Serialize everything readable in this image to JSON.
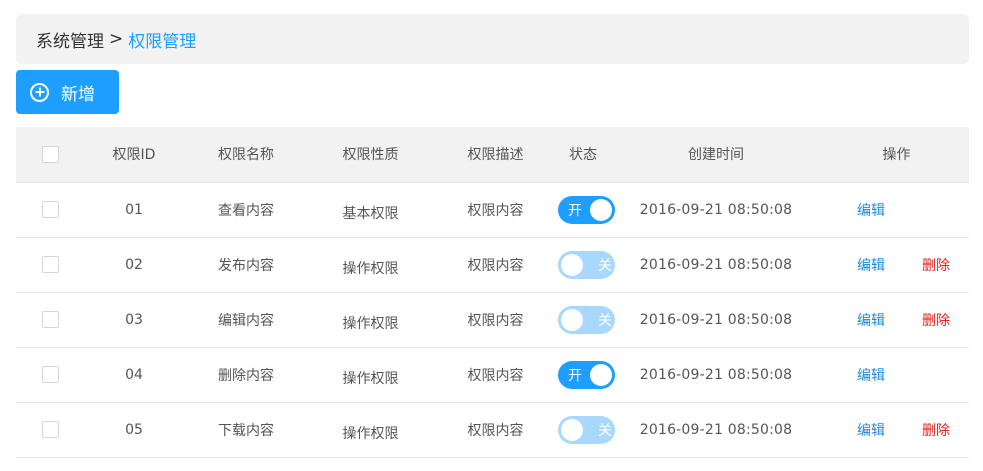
{
  "breadcrumb": {
    "root": "系统管理",
    "separator": ">",
    "current": "权限管理"
  },
  "toolbar": {
    "add_label": "新增",
    "add_icon": "plus-circle-icon"
  },
  "table": {
    "headers": {
      "id": "权限ID",
      "name": "权限名称",
      "nature": "权限性质",
      "desc": "权限描述",
      "status": "状态",
      "created": "创建时间",
      "ops": "操作"
    },
    "rows": [
      {
        "id": "01",
        "name": "查看内容",
        "nature": "基本权限",
        "desc": "权限内容",
        "status": "开",
        "created": "2016-09-21  08:50:08",
        "edit": "编辑",
        "delete": ""
      },
      {
        "id": "02",
        "name": "发布内容",
        "nature": "操作权限",
        "desc": "权限内容",
        "status": "关",
        "created": "2016-09-21  08:50:08",
        "edit": "编辑",
        "delete": "删除"
      },
      {
        "id": "03",
        "name": "编辑内容",
        "nature": "操作权限",
        "desc": "权限内容",
        "status": "关",
        "created": "2016-09-21  08:50:08",
        "edit": "编辑",
        "delete": "删除"
      },
      {
        "id": "04",
        "name": "删除内容",
        "nature": "操作权限",
        "desc": "权限内容",
        "status": "开",
        "created": "2016-09-21  08:50:08",
        "edit": "编辑",
        "delete": ""
      },
      {
        "id": "05",
        "name": "下载内容",
        "nature": "操作权限",
        "desc": "权限内容",
        "status": "关",
        "created": "2016-09-21  08:50:08",
        "edit": "编辑",
        "delete": "删除"
      }
    ]
  },
  "colors": {
    "accent": "#1e9fff",
    "switch_off": "#a8d8ff",
    "delete": "#e0221e",
    "header_bg": "#f2f2f2"
  }
}
